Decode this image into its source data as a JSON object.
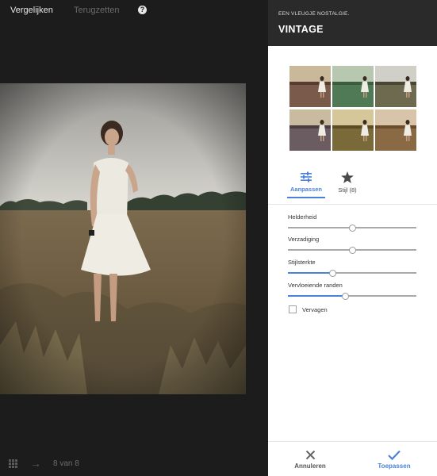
{
  "viewer": {
    "compare_label": "Vergelijken",
    "reset_label": "Terugzetten",
    "help_label": "?",
    "counter": "8 van 8"
  },
  "panel": {
    "subtitle": "EEN VLEUGJE NOSTALGIE.",
    "title": "VINTAGE",
    "tabs": [
      {
        "label": "Aanpassen",
        "icon": "sliders-icon",
        "active": true
      },
      {
        "label": "Stijl (8)",
        "icon": "star-icon",
        "active": false
      }
    ],
    "sliders": [
      {
        "label": "Helderheid",
        "value": 0.5,
        "active_fill": false
      },
      {
        "label": "Verzadiging",
        "value": 0.5,
        "active_fill": false
      },
      {
        "label": "Stijlsterkte",
        "value": 0.35,
        "active_fill": true
      },
      {
        "label": "Vervloeiende randen",
        "value": 0.45,
        "active_fill": true
      }
    ],
    "fade_label": "Vervagen",
    "fade_checked": false,
    "cancel_label": "Annuleren",
    "apply_label": "Toepassen"
  },
  "colors": {
    "accent": "#4a82d8",
    "header_bg": "#2a2a2a",
    "viewer_bg": "#1c1c1c"
  }
}
